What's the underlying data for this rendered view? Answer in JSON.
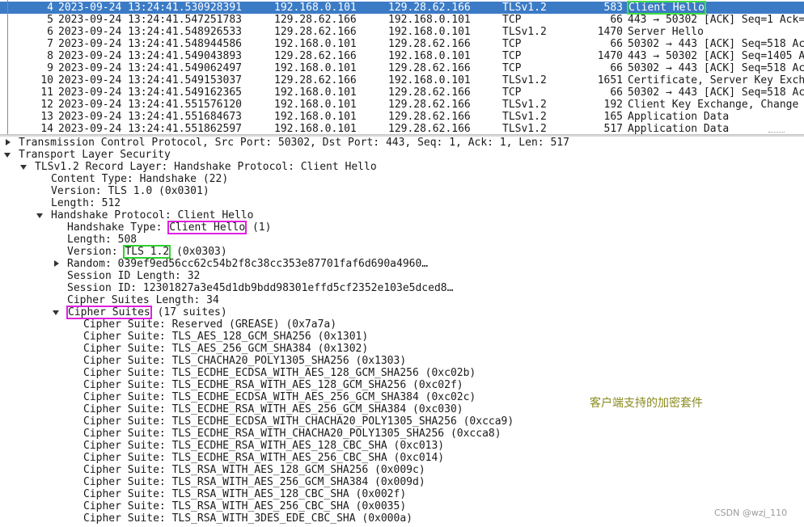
{
  "packets": [
    {
      "no": "4",
      "time": "2023-09-24 13:24:41.530928391",
      "src": "192.168.0.101",
      "dst": "129.28.62.166",
      "proto": "TLSv1.2",
      "len": "583",
      "info": "Client Hello"
    },
    {
      "no": "5",
      "time": "2023-09-24 13:24:41.547251783",
      "src": "129.28.62.166",
      "dst": "192.168.0.101",
      "proto": "TCP",
      "len": "66",
      "info": "443 → 50302 [ACK] Seq=1 Ack="
    },
    {
      "no": "6",
      "time": "2023-09-24 13:24:41.548926533",
      "src": "129.28.62.166",
      "dst": "192.168.0.101",
      "proto": "TLSv1.2",
      "len": "1470",
      "info": "Server Hello"
    },
    {
      "no": "7",
      "time": "2023-09-24 13:24:41.548944586",
      "src": "192.168.0.101",
      "dst": "129.28.62.166",
      "proto": "TCP",
      "len": "66",
      "info": "50302 → 443 [ACK] Seq=518 Ac"
    },
    {
      "no": "8",
      "time": "2023-09-24 13:24:41.549043893",
      "src": "129.28.62.166",
      "dst": "192.168.0.101",
      "proto": "TCP",
      "len": "1470",
      "info": "443 → 50302 [ACK] Seq=1405 A"
    },
    {
      "no": "9",
      "time": "2023-09-24 13:24:41.549062497",
      "src": "192.168.0.101",
      "dst": "129.28.62.166",
      "proto": "TCP",
      "len": "66",
      "info": "50302 → 443 [ACK] Seq=518 Ac"
    },
    {
      "no": "10",
      "time": "2023-09-24 13:24:41.549153037",
      "src": "129.28.62.166",
      "dst": "192.168.0.101",
      "proto": "TLSv1.2",
      "len": "1651",
      "info": "Certificate, Server Key Exch"
    },
    {
      "no": "11",
      "time": "2023-09-24 13:24:41.549162365",
      "src": "192.168.0.101",
      "dst": "129.28.62.166",
      "proto": "TCP",
      "len": "66",
      "info": "50302 → 443 [ACK] Seq=518 Ac"
    },
    {
      "no": "12",
      "time": "2023-09-24 13:24:41.551576120",
      "src": "192.168.0.101",
      "dst": "129.28.62.166",
      "proto": "TLSv1.2",
      "len": "192",
      "info": "Client Key Exchange, Change"
    },
    {
      "no": "13",
      "time": "2023-09-24 13:24:41.551684673",
      "src": "192.168.0.101",
      "dst": "129.28.62.166",
      "proto": "TLSv1.2",
      "len": "165",
      "info": "Application Data"
    },
    {
      "no": "14",
      "time": "2023-09-24 13:24:41.551862597",
      "src": "192.168.0.101",
      "dst": "129.28.62.166",
      "proto": "TLSv1.2",
      "len": "517",
      "info": "Application Data"
    }
  ],
  "details": {
    "tcp_line": "Transmission Control Protocol, Src Port: 50302, Dst Port: 443, Seq: 1, Ack: 1, Len: 517",
    "tls_line": "Transport Layer Security",
    "record_line": "TLSv1.2 Record Layer: Handshake Protocol: Client Hello",
    "content_type": "Content Type: Handshake (22)",
    "version_rec": "Version: TLS 1.0 (0x0301)",
    "length_rec": "Length: 512",
    "handshake_line": "Handshake Protocol: Client Hello",
    "hs_type_prefix": "Handshake Type: ",
    "hs_type_value": "Client Hello",
    "hs_type_suffix": " (1)",
    "hs_length": "Length: 508",
    "hs_version_prefix": "Version: ",
    "hs_version_value": "TLS 1.2",
    "hs_version_suffix": " (0x0303)",
    "random": "Random: 039ef9ed56cc62c54b2f8c38cc353e87701faf6d690a4960…",
    "session_id_length": "Session ID Length: 32",
    "session_id": "Session ID: 12301827a3e45d1db9bdd98301effd5cf2352e103e5dced8…",
    "cipher_suites_length": "Cipher Suites Length: 34",
    "cipher_suites_label": "Cipher Suites",
    "cipher_suites_count": " (17 suites)",
    "cipher_suites": [
      "Cipher Suite: Reserved (GREASE) (0x7a7a)",
      "Cipher Suite: TLS_AES_128_GCM_SHA256 (0x1301)",
      "Cipher Suite: TLS_AES_256_GCM_SHA384 (0x1302)",
      "Cipher Suite: TLS_CHACHA20_POLY1305_SHA256 (0x1303)",
      "Cipher Suite: TLS_ECDHE_ECDSA_WITH_AES_128_GCM_SHA256 (0xc02b)",
      "Cipher Suite: TLS_ECDHE_RSA_WITH_AES_128_GCM_SHA256 (0xc02f)",
      "Cipher Suite: TLS_ECDHE_ECDSA_WITH_AES_256_GCM_SHA384 (0xc02c)",
      "Cipher Suite: TLS_ECDHE_RSA_WITH_AES_256_GCM_SHA384 (0xc030)",
      "Cipher Suite: TLS_ECDHE_ECDSA_WITH_CHACHA20_POLY1305_SHA256 (0xcca9)",
      "Cipher Suite: TLS_ECDHE_RSA_WITH_CHACHA20_POLY1305_SHA256 (0xcca8)",
      "Cipher Suite: TLS_ECDHE_RSA_WITH_AES_128_CBC_SHA (0xc013)",
      "Cipher Suite: TLS_ECDHE_RSA_WITH_AES_256_CBC_SHA (0xc014)",
      "Cipher Suite: TLS_RSA_WITH_AES_128_GCM_SHA256 (0x009c)",
      "Cipher Suite: TLS_RSA_WITH_AES_256_GCM_SHA384 (0x009d)",
      "Cipher Suite: TLS_RSA_WITH_AES_128_CBC_SHA (0x002f)",
      "Cipher Suite: TLS_RSA_WITH_AES_256_CBC_SHA (0x0035)",
      "Cipher Suite: TLS_RSA_WITH_3DES_EDE_CBC_SHA (0x000a)"
    ]
  },
  "annotation": "客户端支持的加密套件",
  "watermark": "CSDN @wzj_110",
  "colors": {
    "selected_row": "#3b7bc6",
    "highlight_green": "#2fd02f",
    "highlight_magenta": "#e020e0",
    "annotation": "#8a8a1e"
  }
}
